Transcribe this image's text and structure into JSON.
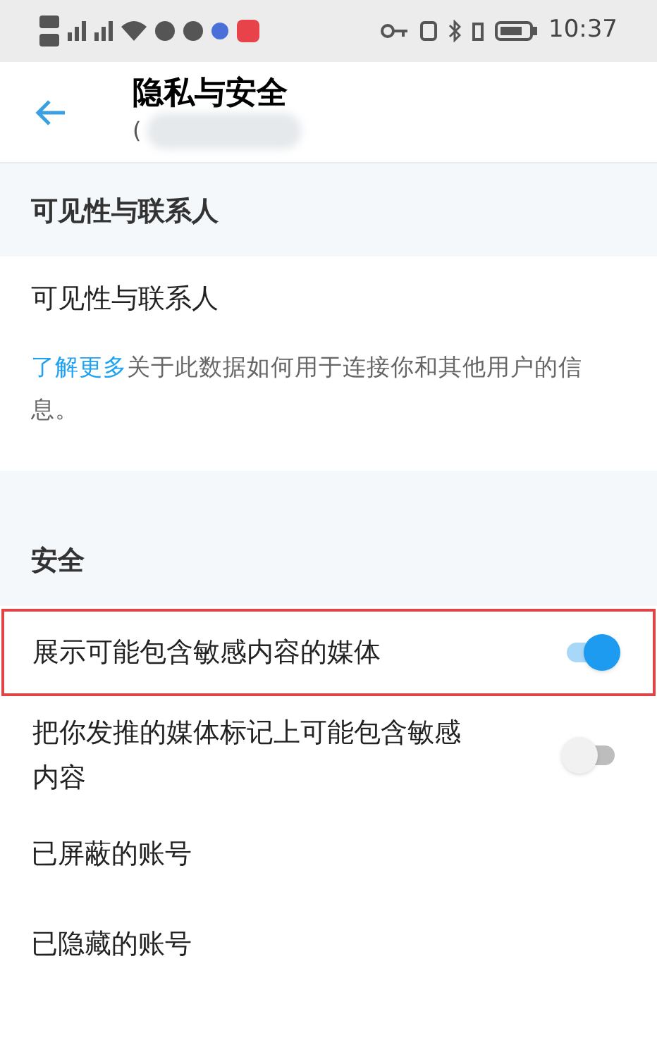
{
  "status_bar": {
    "time": "10:37"
  },
  "header": {
    "title": "隐私与安全",
    "subtitle": "("
  },
  "sections": [
    {
      "title": "可见性与联系人",
      "items": [
        {
          "kind": "link",
          "label": "可见性与联系人"
        },
        {
          "kind": "info",
          "link": "了解更多",
          "text": "关于此数据如何用于连接你和其他用户的信息。"
        }
      ]
    },
    {
      "title": "安全",
      "items": [
        {
          "kind": "toggle",
          "label": "展示可能包含敏感内容的媒体",
          "on": true,
          "highlighted": true
        },
        {
          "kind": "toggle",
          "label": "把你发推的媒体标记上可能包含敏感内容",
          "on": false,
          "highlighted": false
        },
        {
          "kind": "link",
          "label": "已屏蔽的账号"
        },
        {
          "kind": "link",
          "label": "已隐藏的账号"
        }
      ]
    }
  ]
}
